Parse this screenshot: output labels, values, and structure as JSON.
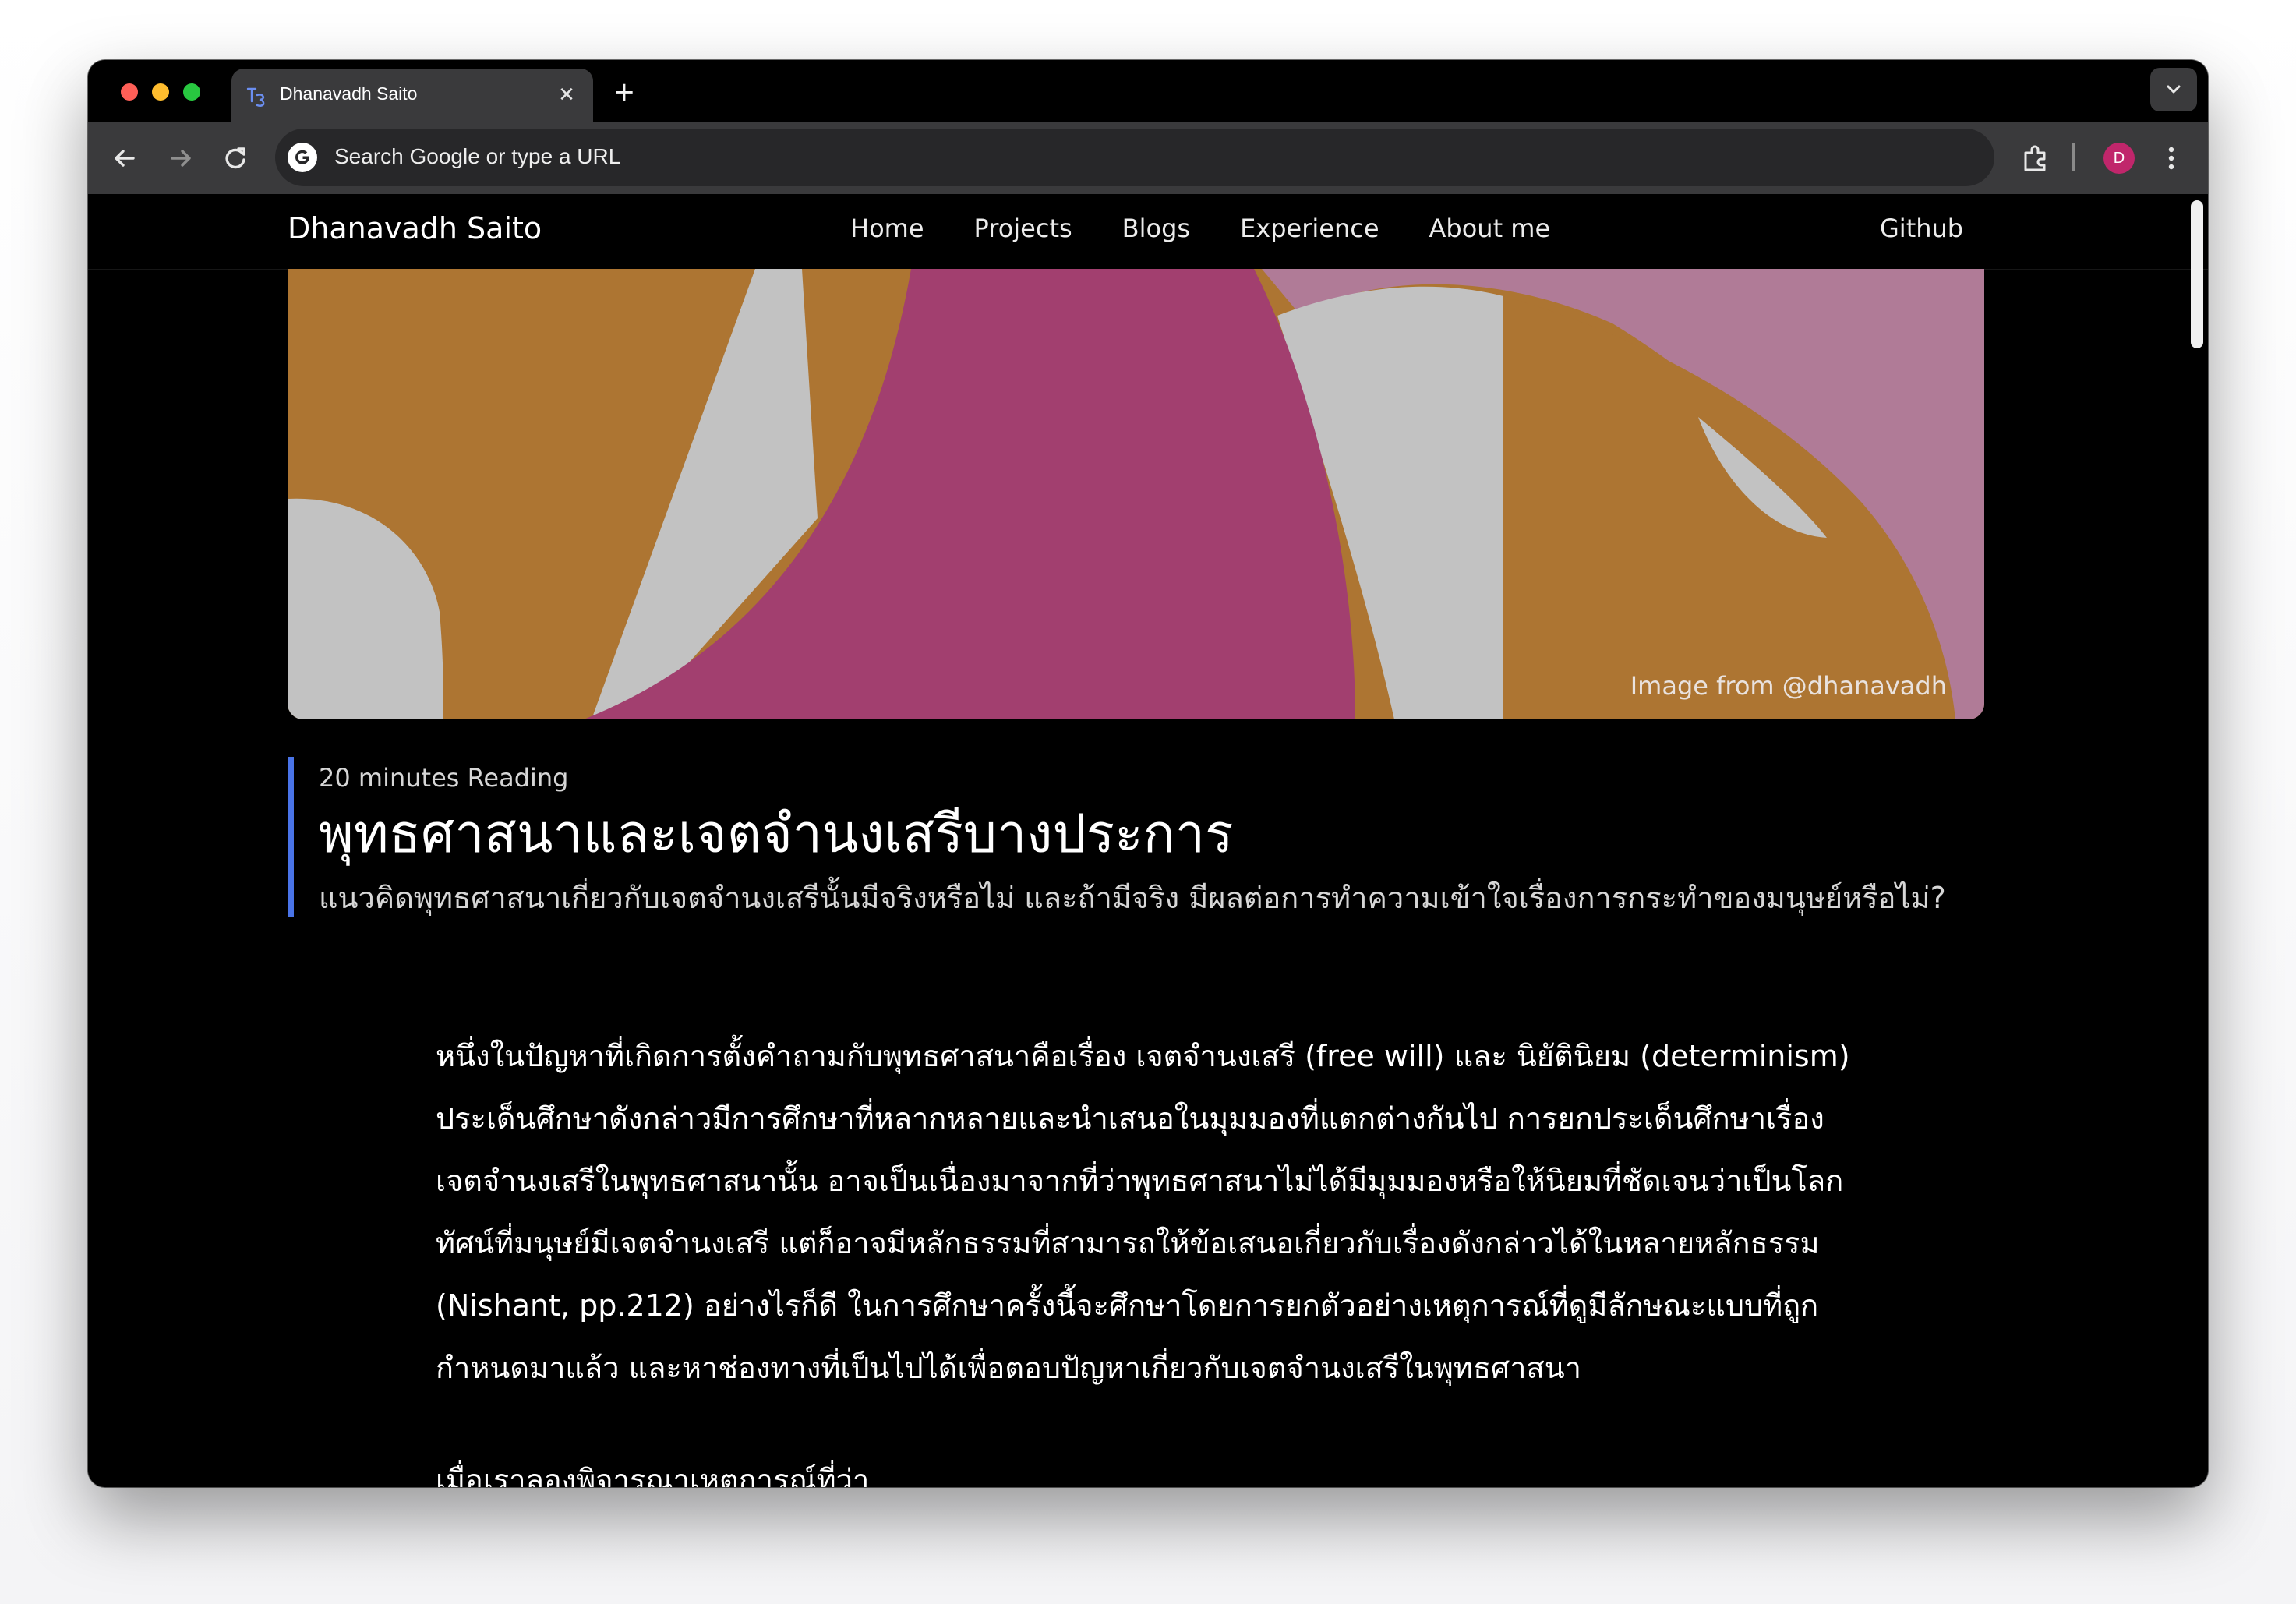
{
  "browser": {
    "tab_title": "Dhanavadh Saito",
    "tab_close_glyph": "✕",
    "new_tab_glyph": "+",
    "omnibox_placeholder": "Search Google or type a URL",
    "profile_initial": "D",
    "icons": [
      "back-icon",
      "forward-icon",
      "reload-icon",
      "google-icon",
      "extensions-icon",
      "kebab-menu-icon",
      "tab-search-chevron-icon"
    ]
  },
  "site": {
    "brand": "Dhanavadh Saito",
    "nav": [
      "Home",
      "Projects",
      "Blogs",
      "Experience",
      "About me"
    ],
    "github": "Github"
  },
  "hero": {
    "credit": "Image from @dhanavadh",
    "colors": {
      "ochre": "#ad7532",
      "grey": "#c2c2c2",
      "magenta": "#a23f6f",
      "mauve": "#b07b97"
    }
  },
  "article": {
    "reading_time": "20 minutes Reading",
    "title": "พุทธศาสนาและเจตจำนงเสรีบางประการ",
    "subtitle": "แนวคิดพุทธศาสนาเกี่ยวกับเจตจำนงเสรีนั้นมีจริงหรือไม่ และถ้ามีจริง มีผลต่อการทำความเข้าใจเรื่องการกระทำของมนุษย์หรือไม่?",
    "paragraph1": [
      "หนึ่งในปัญหาที่เกิดการตั้งคำถามกับพุทธศาสนาคือเรื่อง เจตจำนงเสรี (free will) และ นิยัตินิยม (determinism)",
      "ประเด็นศึกษาดังกล่าวมีการศึกษาที่หลากหลายและนำเสนอในมุมมองที่แตกต่างกันไป การยกประเด็นศึกษาเรื่อง",
      "เจตจำนงเสรีในพุทธศาสนานั้น อาจเป็นเนื่องมาจากที่ว่าพุทธศาสนาไม่ได้มีมุมมองหรือให้นิยมที่ชัดเจนว่าเป็นโลก",
      "ทัศน์ที่มนุษย์มีเจตจำนงเสรี แต่ก็อาจมีหลักธรรมที่สามารถให้ข้อเสนอเกี่ยวกับเรื่องดังกล่าวได้ในหลายหลักธรรม",
      "(Nishant, pp.212) อย่างไรก็ดี ในการศึกษาครั้งนี้จะศึกษาโดยการยกตัวอย่างเหตุการณ์ที่ดูมีลักษณะแบบที่ถูก",
      "กำหนดมาแล้ว และหาช่องทางที่เป็นไปได้เพื่อตอบปัญหาเกี่ยวกับเจตจำนงเสรีในพุทธศาสนา"
    ],
    "paragraph2": "เมื่อเราลองพิจารณาเหตุการณ์ที่ว่า"
  }
}
